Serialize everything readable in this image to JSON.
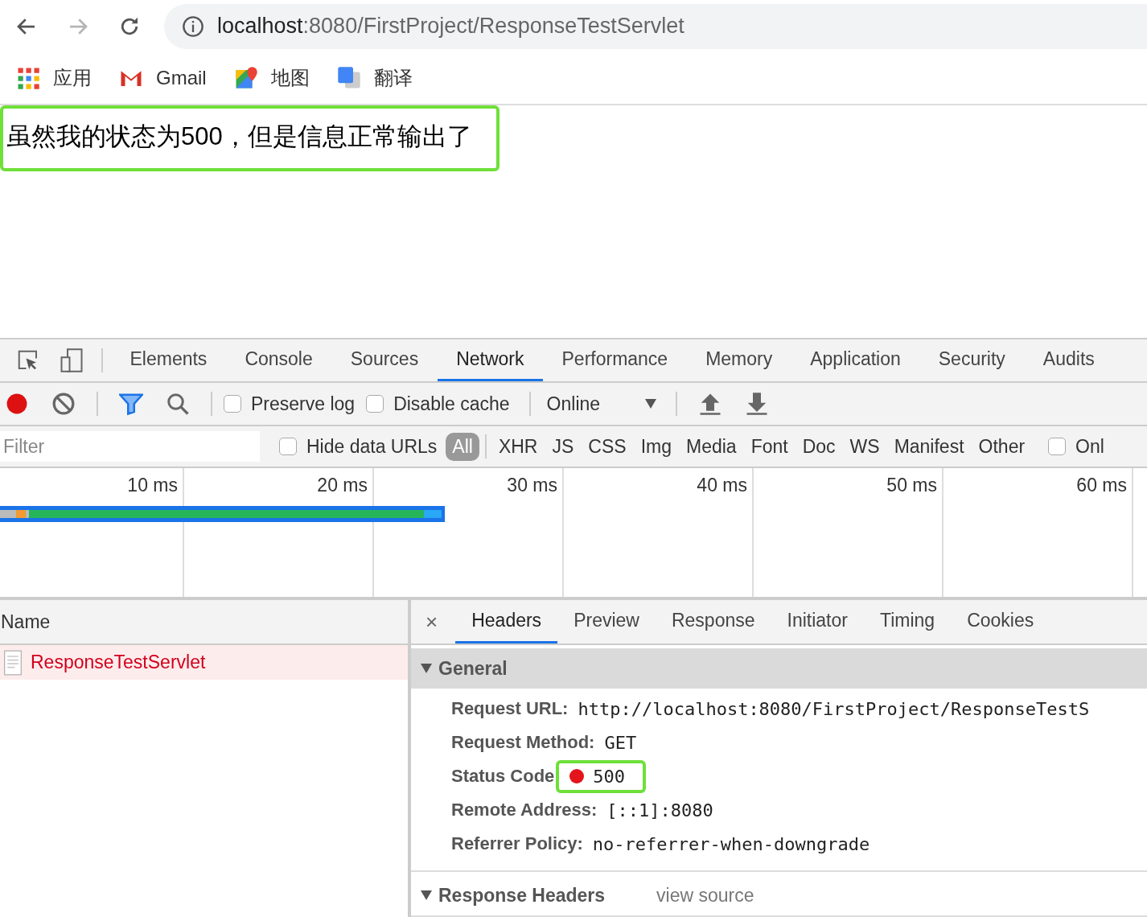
{
  "browser": {
    "nav": [
      {
        "kind": "back",
        "disabled": false
      },
      {
        "kind": "forward",
        "disabled": true
      },
      {
        "kind": "reload",
        "disabled": false
      }
    ],
    "url_host": "localhost",
    "url_rest": ":8080/FirstProject/ResponseTestServlet",
    "bookmarks": [
      {
        "kind": "apps",
        "label": "应用"
      },
      {
        "kind": "gmail",
        "label": "Gmail"
      },
      {
        "kind": "maps",
        "label": "地图"
      },
      {
        "kind": "translate",
        "label": "翻译"
      }
    ]
  },
  "page": {
    "message": "虽然我的状态为500，但是信息正常输出了",
    "highlighted": true
  },
  "devtools": {
    "tabs": [
      {
        "label": "Elements",
        "selected": false
      },
      {
        "label": "Console",
        "selected": false
      },
      {
        "label": "Sources",
        "selected": false
      },
      {
        "label": "Network",
        "selected": true
      },
      {
        "label": "Performance",
        "selected": false
      },
      {
        "label": "Memory",
        "selected": false
      },
      {
        "label": "Application",
        "selected": false
      },
      {
        "label": "Security",
        "selected": false
      },
      {
        "label": "Audits",
        "selected": false
      }
    ],
    "toolbar": {
      "recording": true,
      "checkboxes": [
        {
          "label": "Preserve log",
          "checked": false
        },
        {
          "label": "Disable cache",
          "checked": false
        }
      ],
      "throttling": "Online"
    },
    "filter": {
      "placeholder": "Filter",
      "hide_data_urls": {
        "label": "Hide data URLs",
        "checked": false
      },
      "types": [
        {
          "label": "All",
          "selected": true
        },
        {
          "label": "XHR",
          "selected": false
        },
        {
          "label": "JS",
          "selected": false
        },
        {
          "label": "CSS",
          "selected": false
        },
        {
          "label": "Img",
          "selected": false
        },
        {
          "label": "Media",
          "selected": false
        },
        {
          "label": "Font",
          "selected": false
        },
        {
          "label": "Doc",
          "selected": false
        },
        {
          "label": "WS",
          "selected": false
        },
        {
          "label": "Manifest",
          "selected": false
        },
        {
          "label": "Other",
          "selected": false
        }
      ],
      "only": {
        "label": "Onl",
        "checked": false
      }
    },
    "timeline": {
      "ticks": [
        "10 ms",
        "20 ms",
        "30 ms",
        "40 ms",
        "50 ms",
        "60 ms"
      ]
    },
    "requests": {
      "column": "Name",
      "rows": [
        {
          "name": "ResponseTestServlet",
          "selected": true,
          "error": true
        }
      ]
    },
    "details": {
      "close": "×",
      "tabs": [
        {
          "label": "Headers",
          "selected": true
        },
        {
          "label": "Preview",
          "selected": false
        },
        {
          "label": "Response",
          "selected": false
        },
        {
          "label": "Initiator",
          "selected": false
        },
        {
          "label": "Timing",
          "selected": false
        },
        {
          "label": "Cookies",
          "selected": false
        }
      ],
      "sections": [
        {
          "title": "General",
          "expanded": true,
          "shaded": true,
          "rows": [
            {
              "label": "Request URL:",
              "value": "http://localhost:8080/FirstProject/ResponseTestS"
            },
            {
              "label": "Request Method:",
              "value": "GET"
            },
            {
              "label": "Status Code",
              "value": "500",
              "color": "#e3141b",
              "highlighted": true
            },
            {
              "label": "Remote Address:",
              "value": "[::1]:8080"
            },
            {
              "label": "Referrer Policy:",
              "value": "no-referrer-when-downgrade"
            }
          ]
        },
        {
          "title": "Response Headers",
          "expanded": true,
          "shaded": false,
          "link": "view source"
        }
      ]
    }
  }
}
